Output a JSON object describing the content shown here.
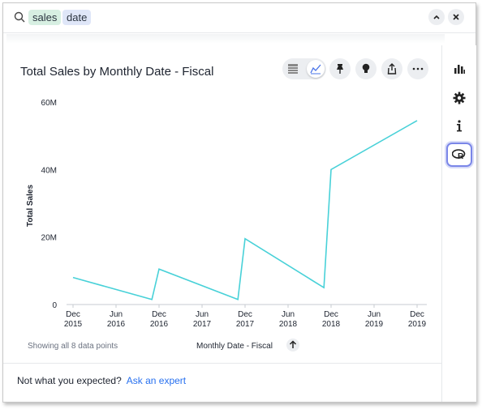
{
  "search": {
    "chips": [
      "sales",
      "date"
    ]
  },
  "card": {
    "title": "Total Sales by Monthly Date - Fiscal",
    "points_note": "Showing all 8 data points",
    "x_axis_label": "Monthly Date - Fiscal",
    "y_axis_label": "Total Sales"
  },
  "footer": {
    "question": "Not what you expected?",
    "link": "Ask an expert"
  },
  "chart_data": {
    "type": "line",
    "xlabel": "Monthly Date - Fiscal",
    "ylabel": "Total Sales",
    "ylim": [
      0,
      60000000
    ],
    "y_ticks": [
      "0",
      "20M",
      "40M",
      "60M"
    ],
    "x_tick_labels": [
      [
        "Dec",
        "2015"
      ],
      [
        "Jun",
        "2016"
      ],
      [
        "Dec",
        "2016"
      ],
      [
        "Jun",
        "2017"
      ],
      [
        "Dec",
        "2017"
      ],
      [
        "Jun",
        "2018"
      ],
      [
        "Dec",
        "2018"
      ],
      [
        "Jun",
        "2019"
      ],
      [
        "Dec",
        "2019"
      ]
    ],
    "x": [
      "Dec 2015",
      "Nov 2016",
      "Dec 2016",
      "Nov 2017",
      "Dec 2017",
      "Nov 2018",
      "Dec 2018",
      "Dec 2019"
    ],
    "values": [
      8000000,
      1500000,
      10500000,
      1500000,
      19500000,
      5000000,
      40000000,
      54500000
    ],
    "series_color": "#48d1d8",
    "grid": false
  }
}
